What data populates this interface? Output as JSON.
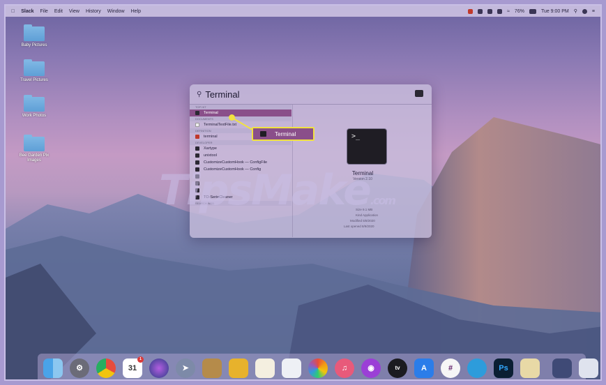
{
  "menubar": {
    "app_name": "Slack",
    "items": [
      "File",
      "Edit",
      "View",
      "History",
      "Window",
      "Help"
    ],
    "battery": "76%",
    "clock": "Tue 9:00 PM"
  },
  "desktop_folders": [
    {
      "label": "Baby Pictures"
    },
    {
      "label": "Travel Pictures"
    },
    {
      "label": "Work Photos"
    },
    {
      "label": "Bee Garden Pix Images"
    }
  ],
  "spotlight": {
    "query": "Terminal",
    "sections": {
      "top_hit": "Top Hit",
      "documents": "Documents",
      "definition": "Definition",
      "developer": "Developer"
    },
    "results": {
      "top_hit": "Terminal",
      "document": "TerminalTextFile.txt",
      "definition": "terminal",
      "dev1": "Xartype",
      "dev2": "unixtool",
      "dev3": "CustomizeCustomHook — ConfigFile",
      "dev4": "CustomizeCustomHook — Config",
      "dev5": "",
      "dev6": "",
      "dev7": "",
      "dev8": "TO-SerieCleaner",
      "search_web": "Search Web"
    },
    "preview": {
      "title": "Terminal",
      "version": "Version 2.10",
      "meta1": "Size  9.1 MB",
      "meta2": "Kind  Application",
      "meta3": "Modified  5/8/2020",
      "meta4": "Last opened  8/9/2020"
    }
  },
  "callout": {
    "label": "Terminal"
  },
  "watermark": {
    "text": "TipsMake",
    "suffix": ".com"
  },
  "dock": {
    "calendar_day": "31",
    "calendar_badge": "1",
    "ps_label": "Ps",
    "tv_label": "tv"
  },
  "colors": {
    "selection": "#8a4f8a",
    "callout_border": "#f1e240"
  }
}
